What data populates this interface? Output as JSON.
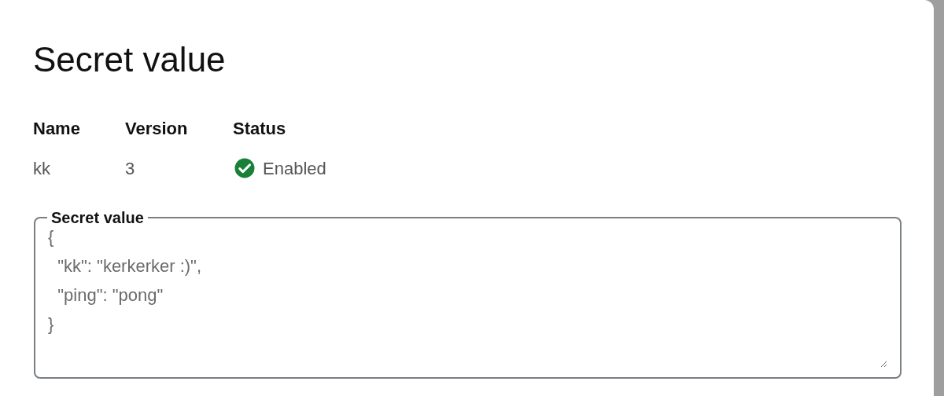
{
  "dialog": {
    "title": "Secret value"
  },
  "details": {
    "columns": [
      "Name",
      "Version",
      "Status"
    ],
    "values": {
      "name": "kk",
      "version": "3",
      "status": {
        "label": "Enabled",
        "enabled": true
      }
    }
  },
  "secret_field": {
    "label": "Secret value",
    "value": "{\n  \"kk\": \"kerkerker :)\",\n  \"ping\": \"pong\"\n}"
  }
}
